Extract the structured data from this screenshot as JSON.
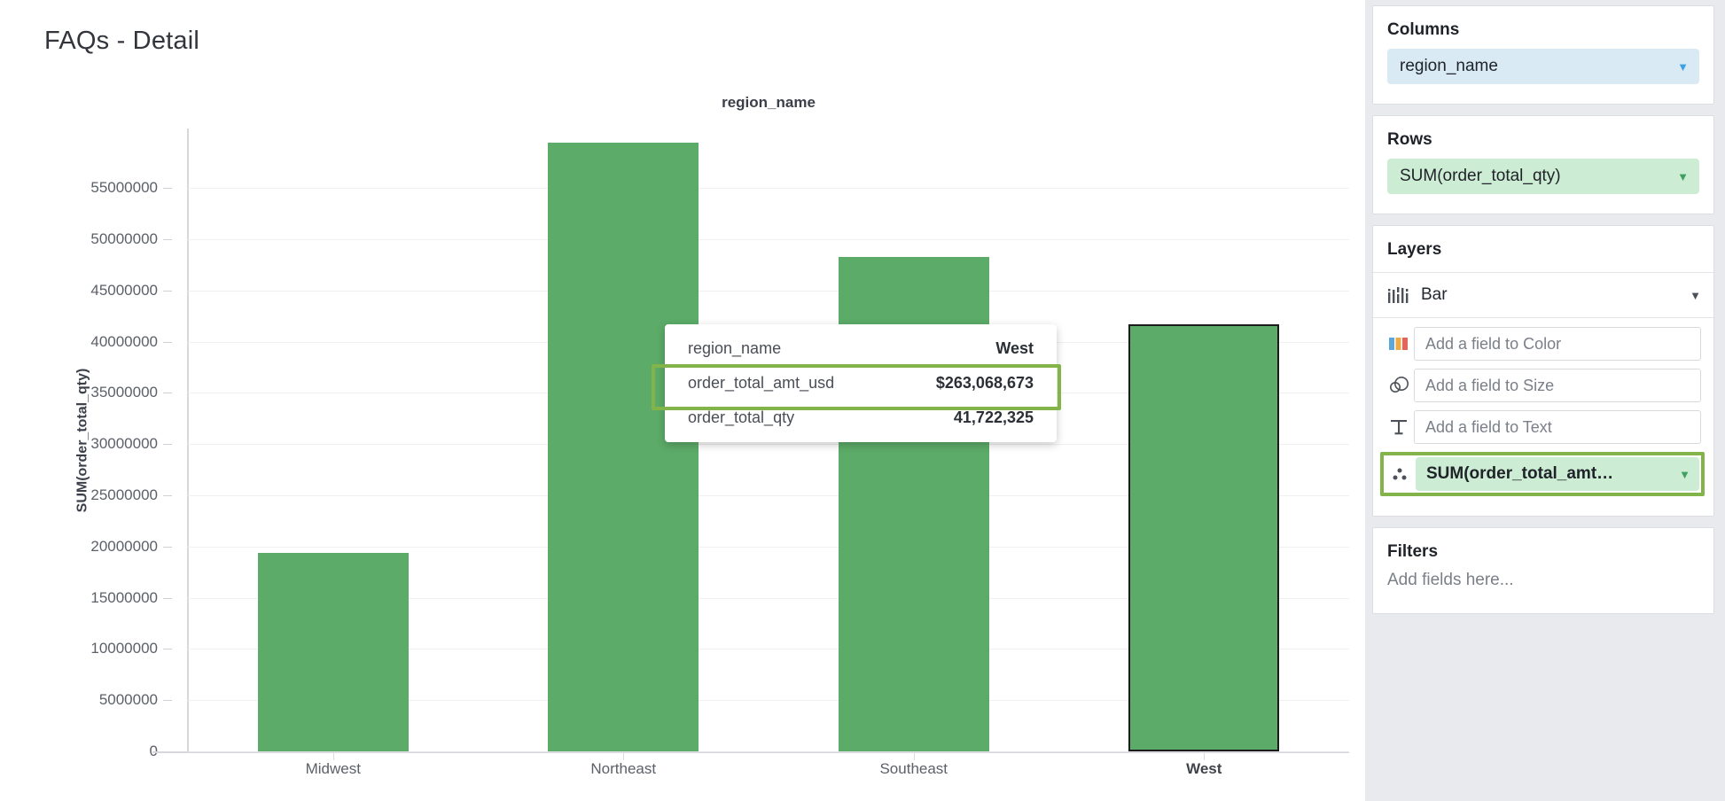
{
  "viz": {
    "title": "FAQs - Detail",
    "chart_header": "region_name"
  },
  "tooltip": {
    "rows": [
      {
        "key": "region_name",
        "value": "West",
        "highlighted": false
      },
      {
        "key": "order_total_amt_usd",
        "value": "$263,068,673",
        "highlighted": true
      },
      {
        "key": "order_total_qty",
        "value": "41,722,325",
        "highlighted": false
      }
    ]
  },
  "panel": {
    "columns": {
      "title": "Columns",
      "pill": "region_name",
      "caret": "▼"
    },
    "rows": {
      "title": "Rows",
      "pill": "SUM(order_total_qty)",
      "caret": "▼"
    },
    "layers": {
      "title": "Layers",
      "type_label": "Bar",
      "type_caret": "▼",
      "encodings": [
        {
          "icon": "color-swatches-icon",
          "placeholder": "Add a field to Color",
          "value": null
        },
        {
          "icon": "size-circles-icon",
          "placeholder": "Add a field to Size",
          "value": null
        },
        {
          "icon": "text-T-icon",
          "placeholder": "Add a field to Text",
          "value": null
        }
      ],
      "detail": {
        "icon": "detail-dots-icon",
        "value": "SUM(order_total_amt…",
        "caret": "▼"
      }
    },
    "filters": {
      "title": "Filters",
      "placeholder": "Add fields here..."
    }
  },
  "colors": {
    "bar_green": "#5cab68",
    "highlight_green": "#82b44a",
    "pill_blue": "#d9eaf5",
    "pill_green": "#cdecd4",
    "panel_bg": "#e8eaee",
    "selected_bar_border": "#1b1b1b"
  },
  "chart_data": {
    "type": "bar",
    "title": "region_name",
    "xlabel": "region_name",
    "ylabel": "SUM(order_total_qty)",
    "categories": [
      "Midwest",
      "Northeast",
      "Southeast",
      "West"
    ],
    "values": [
      19400000,
      59400000,
      48300000,
      41722325
    ],
    "selected_category": "West",
    "ylim": [
      0,
      60800000
    ],
    "yticks": [
      0,
      5000000,
      10000000,
      15000000,
      20000000,
      25000000,
      30000000,
      35000000,
      40000000,
      45000000,
      50000000,
      55000000
    ],
    "ytick_labels": [
      "0",
      "5000000",
      "10000000",
      "15000000",
      "20000000",
      "25000000",
      "30000000",
      "35000000",
      "40000000",
      "45000000",
      "50000000",
      "55000000"
    ],
    "grid": true,
    "legend": "none",
    "series": [
      {
        "name": "SUM(order_total_qty)",
        "values": [
          19400000,
          59400000,
          48300000,
          41722325
        ]
      }
    ],
    "annotations": [
      {
        "type": "tooltip",
        "category": "West",
        "order_total_amt_usd": "$263,068,673",
        "order_total_qty": "41,722,325"
      }
    ]
  }
}
